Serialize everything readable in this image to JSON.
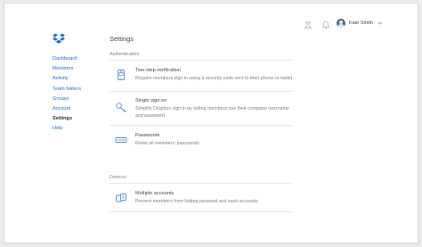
{
  "header": {
    "user_name": "Kate Smith"
  },
  "sidebar": {
    "items": [
      {
        "label": "Dashboard"
      },
      {
        "label": "Members"
      },
      {
        "label": "Activity"
      },
      {
        "label": "Team folders"
      },
      {
        "label": "Groups"
      },
      {
        "label": "Account"
      },
      {
        "label": "Settings"
      },
      {
        "label": "Help"
      }
    ],
    "active": "Settings"
  },
  "main": {
    "title": "Settings",
    "sections": [
      {
        "label": "Authentication",
        "rows": [
          {
            "icon": "phone-verification-icon",
            "title": "Two-step verification",
            "desc": "Require members sign in using a security code sent to their phone or tablet"
          },
          {
            "icon": "key-icon",
            "title": "Single sign-on",
            "desc": "Simplify Dropbox sign in by letting members use their company username and password"
          },
          {
            "icon": "password-keyboard-icon",
            "title": "Passwords",
            "desc": "Reset all members' passwords"
          }
        ]
      },
      {
        "label": "Devices",
        "rows": [
          {
            "icon": "multiple-accounts-icon",
            "title": "Multiple accounts",
            "desc": "Prevent members from linking personal and work accounts"
          }
        ]
      }
    ]
  },
  "colors": {
    "link": "#1d6fd0",
    "text": "#3d464d",
    "muted": "#7b848b",
    "icon": "#5a8fc6",
    "logo": "#2273d6"
  }
}
